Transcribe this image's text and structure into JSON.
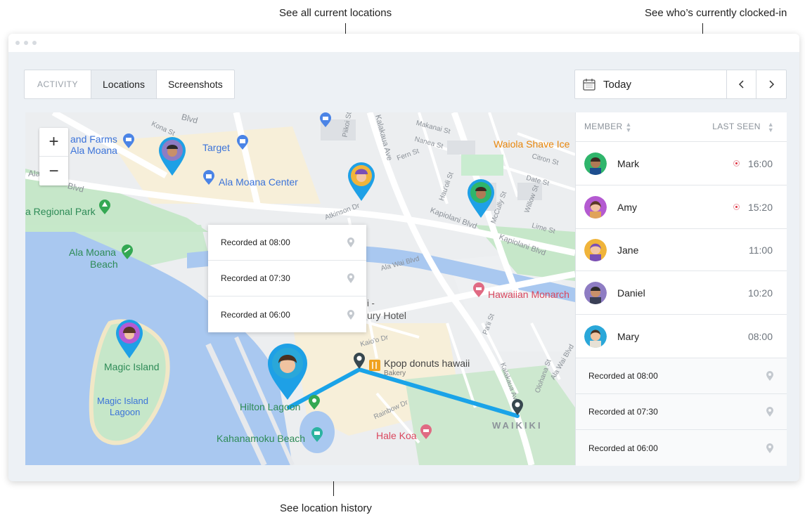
{
  "callouts": {
    "locations": "See all current locations",
    "clocked_in": "See who’s currently clocked-in",
    "history": "See location history"
  },
  "tabs": {
    "label": "ACTIVITY",
    "items": [
      {
        "label": "Locations",
        "active": true
      },
      {
        "label": "Screenshots",
        "active": false
      }
    ]
  },
  "date": {
    "label": "Today",
    "prev_icon": "chevron-left-icon",
    "next_icon": "chevron-right-icon"
  },
  "map": {
    "zoom_in": "+",
    "zoom_out": "−",
    "places": {
      "farms": "and Farms",
      "ala_moana": "Ala Moana",
      "target": "Target",
      "ala_moana_center": "Ala Moana Center",
      "regional_park": "a Regional Park",
      "ala_moana_beach": "Ala Moana",
      "beach": "Beach",
      "magic_island": "Magic Island",
      "magic_island_lagoon_1": "Magic Island",
      "magic_island_lagoon_2": "Lagoon",
      "hilton_lagoon": "Hilton Lagoon",
      "kahanamoku": "Kahanamoku Beach",
      "kpop": "Kpop donuts hawaii",
      "bakery": "Bakery",
      "hale_koa": "Hale Koa",
      "waikiki": "WAIKIKI",
      "hawaiian_monarch": "Hawaiian Monarch",
      "waiola": "Waiola Shave Ice",
      "hotel": "ury Hotel",
      "hotel_prefix": "i -"
    },
    "streets": {
      "kona": "Kona St",
      "blvd_top": "Blvd",
      "ala": "Ala",
      "blvd_left": "Blvd",
      "kalakaua": "Kalakaua Ave",
      "kalakaua2": "Kalakaua Ave",
      "kapiolani": "Kapiolani Blvd",
      "kapiolani2": "Kapiolani Blvd",
      "mccully": "McCully St",
      "atkinson": "Atkinson Dr",
      "ala_wai": "Ala Wai Blvd",
      "ala_wai2": "Ala Wai Blvd",
      "malanai": "Makanai St",
      "nanea": "Nanea St",
      "fern": "Fern St",
      "citron": "Citron St",
      "date": "Date St",
      "lime": "Lime St",
      "rainbow": "Rainbow Dr",
      "kaio": "Kaio'o Dr",
      "olohana": "Olohana St",
      "paoa": "Pa'ii St",
      "piikoi": "Piikoi St",
      "hau": "Hau'oli St",
      "willow": "Willow St"
    }
  },
  "history_popup": [
    {
      "label": "Recorded at 08:00",
      "icon": "location-pin-icon"
    },
    {
      "label": "Recorded at 07:30",
      "icon": "location-pin-icon"
    },
    {
      "label": "Recorded at 06:00",
      "icon": "location-pin-icon"
    }
  ],
  "panel": {
    "member_header": "MEMBER",
    "last_seen_header": "LAST SEEN",
    "members": [
      {
        "name": "Mark",
        "time": "16:00",
        "live": true,
        "bg": "#2fb56b",
        "skin": "#b07a55",
        "hair": "#3b2a22"
      },
      {
        "name": "Amy",
        "time": "15:20",
        "live": true,
        "bg": "#b45ad1",
        "skin": "#f1c2a2",
        "hair": "#5a3826"
      },
      {
        "name": "Jane",
        "time": "11:00",
        "live": false,
        "bg": "#f0b43a",
        "skin": "#f3c6a6",
        "hair": "#7a4fb6"
      },
      {
        "name": "Daniel",
        "time": "10:20",
        "live": false,
        "bg": "#8e7cc3",
        "skin": "#c8906a",
        "hair": "#2c2a2a"
      },
      {
        "name": "Mary",
        "time": "08:00",
        "live": false,
        "bg": "#2aa7d9",
        "skin": "#f0c3a0",
        "hair": "#4a3020"
      }
    ],
    "records": [
      {
        "label": "Recorded at 08:00",
        "icon": "location-pin-icon"
      },
      {
        "label": "Recorded at 07:30",
        "icon": "location-pin-icon"
      },
      {
        "label": "Recorded at 06:00",
        "icon": "location-pin-icon"
      }
    ]
  },
  "colors": {
    "pin_blue": "#1ea0e6",
    "route": "#1aa3e8",
    "water": "#a9c8f0",
    "park": "#c6e7c9",
    "sand": "#f7efd9"
  }
}
